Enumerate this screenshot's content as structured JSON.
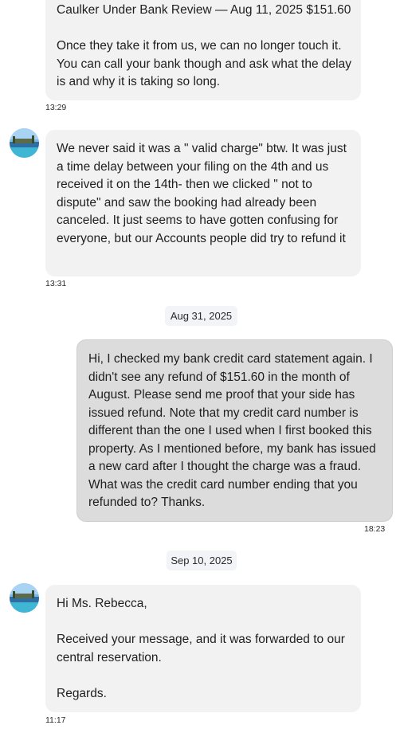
{
  "messages": [
    {
      "text": "Caulker Under Bank Review — Aug 11, 2025 $151.60\n\nOnce they take it from us, we can no longer touch it. You can call your bank though and ask what the delay is and why it is taking so long.",
      "time": "13:29"
    },
    {
      "text": "We never said it was a \" valid charge\" btw. It was just a time delay between your filing on the 4th and us received it on the 14th- then we clicked \" not to dispute\" and saw the booking had already been canceled. It just seems to have gotten confusing for everyone, but our Accounts people did try to refund it",
      "time": "13:31"
    },
    {
      "date": "Aug 31, 2025"
    },
    {
      "text": "Hi, I checked my bank credit card statement again. I didn't see any refund of $151.60 in the month of August. Please send me proof that your side has issued refund. Note that my credit card number is different than the one I used when I first booked this property. As I mentioned before, my bank has issued a new card after I thought the charge was a fraud. What was the credit card number ending that you refunded to? Thanks.",
      "time": "18:23"
    },
    {
      "date": "Sep 10, 2025"
    },
    {
      "text": "Hi Ms. Rebecca,\n\nReceived your message, and it was forwarded to our central reservation.\n\nRegards.",
      "time": "11:17"
    }
  ],
  "colors": {
    "incoming_bubble": "#f2f2f2",
    "outgoing_bubble": "#dcdcdc",
    "date_pill": "#f2f4f8"
  },
  "icons": {
    "avatar": "beach-avatar-icon"
  }
}
